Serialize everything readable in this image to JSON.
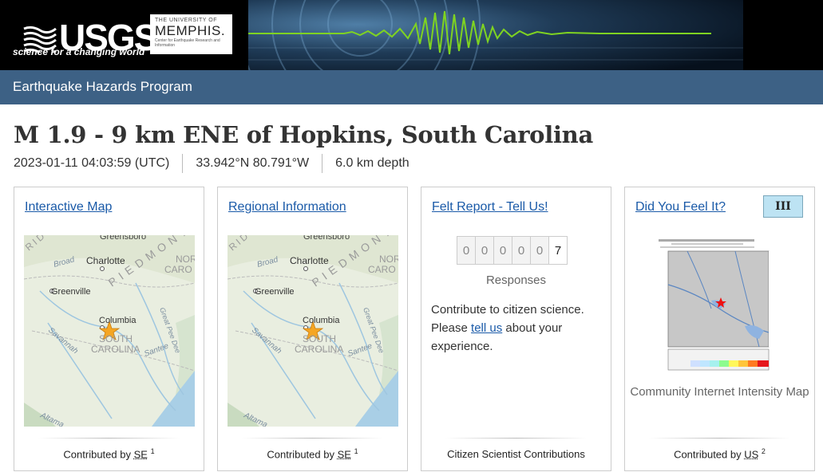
{
  "header": {
    "usgs_word": "USGS",
    "usgs_tagline": "science for a changing world",
    "partner_small": "THE UNIVERSITY OF",
    "partner_big": "MEMPHIS.",
    "partner_sub": "Center for Earthquake Research and Information",
    "program": "Earthquake Hazards Program"
  },
  "event": {
    "title": "M 1.9 - 9 km ENE of Hopkins, South Carolina",
    "time": "2023-01-11 04:03:59 (UTC)",
    "location": "33.942°N 80.791°W",
    "depth": "6.0 km depth"
  },
  "map_labels": {
    "greensboro": "Greensboro",
    "charlotte": "Charlotte",
    "greenville": "Greenville",
    "columbia": "Columbia",
    "piedmont": "PIEDMONT",
    "nor_caro": "NOR",
    "caro": "CARO",
    "south": "SOUTH",
    "carolina": "CAROLINA",
    "broad": "Broad",
    "savannah": "Savannah",
    "santee": "Santee",
    "great_pee_dee": "Great Pee Dee",
    "altamaha": "Altama",
    "ridge": "RID"
  },
  "cards": {
    "interactive_map": {
      "link": "Interactive Map",
      "contributed": "Contributed by ",
      "source": "SE",
      "sup": "1"
    },
    "regional": {
      "link": "Regional Information",
      "contributed": "Contributed by ",
      "source": "SE",
      "sup": "1"
    },
    "felt_report": {
      "link": "Felt Report - Tell Us!",
      "digits": [
        "0",
        "0",
        "0",
        "0",
        "0",
        "7"
      ],
      "responses_label": "Responses",
      "text_before": "Contribute to citizen science. Please ",
      "link_text": "tell us",
      "text_after": " about your experience.",
      "footer": "Citizen Scientist Contributions"
    },
    "dyfi": {
      "link": "Did You Feel It?",
      "badge": "III",
      "caption": "Community Internet Intensity Map",
      "contributed": "Contributed by ",
      "source": "US",
      "sup": "2"
    }
  },
  "colors": {
    "header_bg": "#000000",
    "program_bar": "#3d6185",
    "link": "#1a5aa8",
    "badge_bg": "#bde3f3",
    "epicenter": "#f5a623"
  }
}
